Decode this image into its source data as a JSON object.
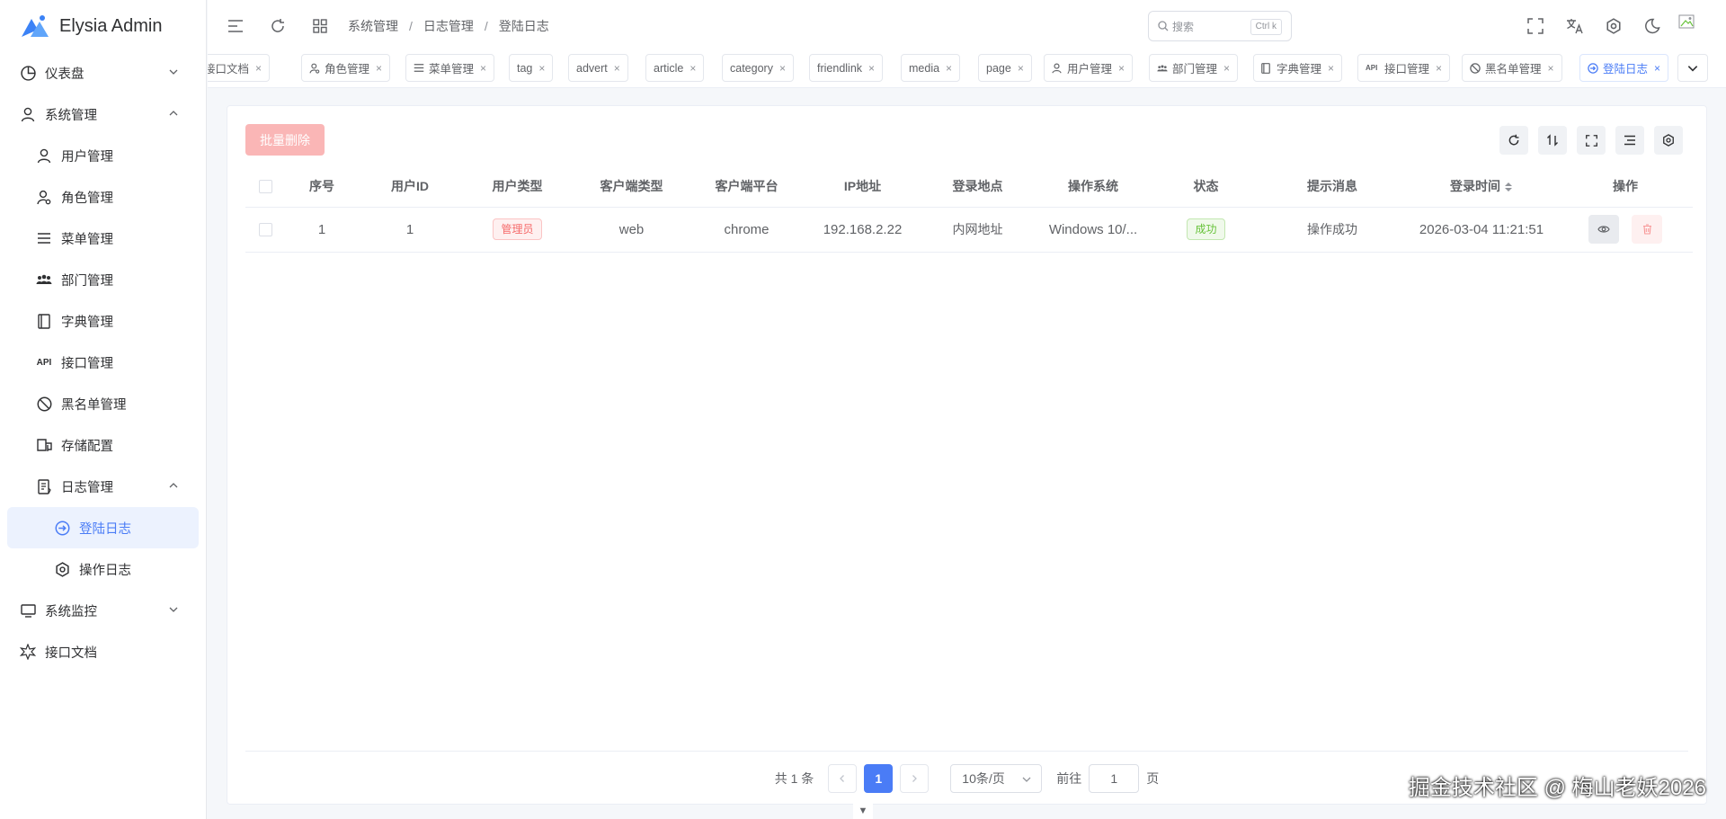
{
  "app": {
    "title": "Elysia Admin",
    "brand_color": "#4a7cf6"
  },
  "sidebar": {
    "items": [
      {
        "label": "仪表盘",
        "icon": "dashboard-icon",
        "arrow": "down"
      },
      {
        "label": "系统管理",
        "icon": "user-icon",
        "arrow": "up"
      },
      {
        "label": "用户管理",
        "icon": "user-icon"
      },
      {
        "label": "角色管理",
        "icon": "user-gear-icon"
      },
      {
        "label": "菜单管理",
        "icon": "menu-icon"
      },
      {
        "label": "部门管理",
        "icon": "team-icon"
      },
      {
        "label": "字典管理",
        "icon": "book-icon"
      },
      {
        "label": "接口管理",
        "icon": "api-icon",
        "icon_text": "API"
      },
      {
        "label": "黑名单管理",
        "icon": "ban-icon"
      },
      {
        "label": "存储配置",
        "icon": "storage-icon"
      },
      {
        "label": "日志管理",
        "icon": "document-icon",
        "arrow": "up"
      },
      {
        "label": "登陆日志",
        "icon": "login-icon"
      },
      {
        "label": "操作日志",
        "icon": "settings-icon"
      },
      {
        "label": "系统监控",
        "icon": "monitor-icon",
        "arrow": "down"
      },
      {
        "label": "接口文档",
        "icon": "api-doc-icon"
      }
    ]
  },
  "header": {
    "breadcrumb": [
      "系统管理",
      "日志管理",
      "登陆日志"
    ],
    "search_placeholder": "搜索",
    "search_shortcut": "Ctrl k"
  },
  "tags": [
    {
      "label": "接口文档"
    },
    {
      "label": "角色管理"
    },
    {
      "label": "菜单管理"
    },
    {
      "label": "tag"
    },
    {
      "label": "advert"
    },
    {
      "label": "article"
    },
    {
      "label": "category"
    },
    {
      "label": "friendlink"
    },
    {
      "label": "media"
    },
    {
      "label": "page"
    },
    {
      "label": "用户管理"
    },
    {
      "label": "部门管理"
    },
    {
      "label": "字典管理"
    },
    {
      "label": "接口管理",
      "icon_text": "API"
    },
    {
      "label": "黑名单管理"
    },
    {
      "label": "登陆日志",
      "active": true
    }
  ],
  "toolbar": {
    "batch_delete": "批量删除"
  },
  "table": {
    "columns": [
      "序号",
      "用户ID",
      "用户类型",
      "客户端类型",
      "客户端平台",
      "IP地址",
      "登录地点",
      "操作系统",
      "状态",
      "提示消息",
      "登录时间",
      "操作"
    ],
    "rows": [
      {
        "index": "1",
        "user_id": "1",
        "user_type": "管理员",
        "client_type": "web",
        "client_platform": "chrome",
        "ip": "192.168.2.22",
        "location": "内网地址",
        "os": "Windows 10/...",
        "status": "成功",
        "message": "操作成功",
        "login_time": "2026-03-04 11:21:51"
      }
    ]
  },
  "pagination": {
    "total_text": "共 1 条",
    "current_page": "1",
    "page_size": "10条/页",
    "goto_label": "前往",
    "goto_value": "1",
    "page_suffix": "页"
  },
  "watermark": "掘金技术社区 @ 梅山老妖2026"
}
